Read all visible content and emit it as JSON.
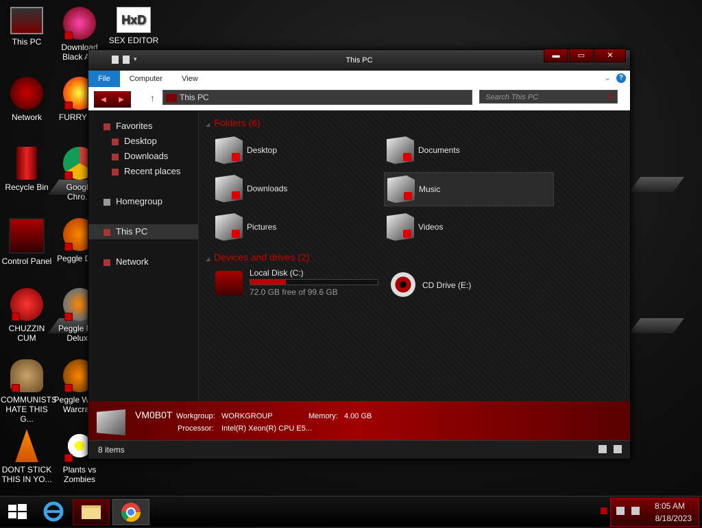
{
  "desktop_icons": [
    {
      "label": "This PC"
    },
    {
      "label": "Download Black A..."
    },
    {
      "label": "SEX EDITOR"
    },
    {
      "label": "Network"
    },
    {
      "label": "FURRY F..."
    },
    {
      "label": "Recycle Bin"
    },
    {
      "label": "Google Chro..."
    },
    {
      "label": "Control Panel"
    },
    {
      "label": "Peggle De..."
    },
    {
      "label": "CHUZZIN CUM"
    },
    {
      "label": "Peggle Ni... Deluxe"
    },
    {
      "label": "COMMUNISTS HATE THIS G..."
    },
    {
      "label": "Peggle W... of Warcra..."
    },
    {
      "label": "DONT STICK THIS IN YO..."
    },
    {
      "label": "Plants vs Zombies"
    }
  ],
  "window": {
    "title": "This PC",
    "ribbon_tabs": [
      "File",
      "Computer",
      "View"
    ],
    "address": "This PC",
    "search_placeholder": "Search This PC",
    "help": "?",
    "min": "▬",
    "max": "▭",
    "close": "✕"
  },
  "nav": {
    "favorites": "Favorites",
    "desktop": "Desktop",
    "downloads": "Downloads",
    "recent": "Recent places",
    "homegroup": "Homegroup",
    "thispc": "This PC",
    "network": "Network"
  },
  "folders": {
    "header": "Folders (6)",
    "items": [
      "Desktop",
      "Documents",
      "Downloads",
      "Music",
      "Pictures",
      "Videos"
    ]
  },
  "drives": {
    "header": "Devices and drives (2)",
    "local": {
      "name": "Local Disk (C:)",
      "info": "72.0 GB free of 99.6 GB",
      "used_fraction": 0.277
    },
    "cd": {
      "name": "CD Drive (E:)"
    }
  },
  "details": {
    "pc_name": "VM0B0T",
    "workgroup_label": "Workgroup:",
    "workgroup": "WORKGROUP",
    "memory_label": "Memory:",
    "memory": "4.00 GB",
    "processor_label": "Processor:",
    "processor": "Intel(R) Xeon(R) CPU E5..."
  },
  "status": {
    "count": "8 items"
  },
  "clock": {
    "time": "8:05 AM",
    "date": "8/18/2023"
  }
}
